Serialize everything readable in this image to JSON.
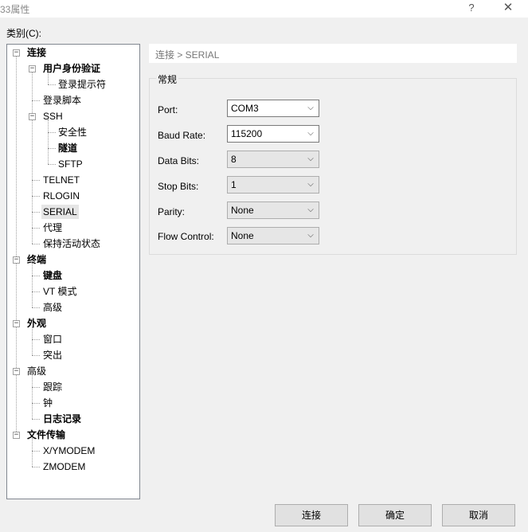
{
  "window": {
    "title": "33属性",
    "help_glyph": "?",
    "close_glyph": "✕"
  },
  "category_label": "类别(C):",
  "tree": {
    "connection": "连接",
    "user_auth": "用户身份验证",
    "login_prompt": "登录提示符",
    "login_script": "登录脚本",
    "ssh": "SSH",
    "security": "安全性",
    "tunnel": "隧道",
    "sftp": "SFTP",
    "telnet": "TELNET",
    "rlogin": "RLOGIN",
    "serial": "SERIAL",
    "proxy": "代理",
    "keepalive": "保持活动状态",
    "terminal": "终端",
    "keyboard": "键盘",
    "vt_mode": "VT 模式",
    "advanced_term": "高级",
    "appearance": "外观",
    "window": "窗口",
    "highlight": "突出",
    "advanced": "高级",
    "trace": "跟踪",
    "bell": "钟",
    "logging": "日志记录",
    "file_transfer": "文件传输",
    "xymodem": "X/YMODEM",
    "zmodem": "ZMODEM"
  },
  "breadcrumb": "连接 > SERIAL",
  "group_title": "常规",
  "fields": {
    "port": {
      "label": "Port:",
      "value": "COM3"
    },
    "baud": {
      "label": "Baud Rate:",
      "value": "115200"
    },
    "data_bits": {
      "label": "Data Bits:",
      "value": "8"
    },
    "stop_bits": {
      "label": "Stop Bits:",
      "value": "1"
    },
    "parity": {
      "label": "Parity:",
      "value": "None"
    },
    "flow": {
      "label": "Flow Control:",
      "value": "None"
    }
  },
  "dropdown_glyph": "⌵",
  "buttons": {
    "connect": "连接",
    "ok": "确定",
    "cancel": "取消"
  }
}
